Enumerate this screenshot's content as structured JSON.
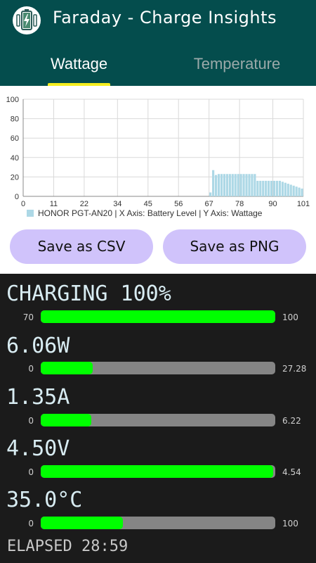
{
  "app": {
    "title": "Faraday - Charge Insights",
    "icon": "battery-charging-icon"
  },
  "tabs": [
    {
      "label": "Wattage",
      "selected": true
    },
    {
      "label": "Temperature",
      "selected": false
    }
  ],
  "colors": {
    "header": "#044d4d",
    "tab_indicator": "#f5ee1f",
    "bar_color": "#add8e6",
    "gauge_fill": "#00ff00",
    "gauge_track": "#858585",
    "button_bg": "#d0c3fb"
  },
  "chart_data": {
    "type": "bar",
    "legend": "HONOR PGT-AN20 | X Axis: Battery Level | Y Axis: Wattage",
    "legend_position": "bottom-left",
    "grid": true,
    "xlim": [
      0,
      101
    ],
    "ylim": [
      0,
      100
    ],
    "x_ticks": [
      "0",
      "11",
      "22",
      "34",
      "45",
      "56",
      "67",
      "78",
      "90",
      "101"
    ],
    "y_ticks": [
      "0",
      "20",
      "40",
      "60",
      "80",
      "100"
    ],
    "x": [
      67,
      68,
      69,
      70,
      71,
      72,
      73,
      74,
      75,
      76,
      77,
      78,
      79,
      80,
      81,
      82,
      83,
      84,
      85,
      86,
      87,
      88,
      89,
      90,
      91,
      92,
      93,
      94,
      95,
      96,
      97,
      98,
      99,
      100
    ],
    "values": [
      4,
      27,
      22,
      23,
      23,
      23,
      23,
      23,
      23,
      23,
      23,
      23,
      23,
      23,
      23,
      23,
      23,
      16,
      16,
      16,
      16,
      16,
      16,
      16,
      16,
      16,
      15,
      14,
      13,
      12,
      11,
      10,
      9,
      8
    ]
  },
  "buttons": {
    "csv": "Save as CSV",
    "png": "Save as PNG"
  },
  "status": {
    "charging": {
      "label": "CHARGING 100%",
      "min": "70",
      "max": "100",
      "fill": 1.0
    },
    "wattage": {
      "label": "6.06W",
      "min": "0",
      "max": "27.28",
      "fill": 0.222
    },
    "current": {
      "label": "1.35A",
      "min": "0",
      "max": "6.22",
      "fill": 0.217
    },
    "voltage": {
      "label": "4.50V",
      "min": "0",
      "max": "4.54",
      "fill": 0.991
    },
    "temperature": {
      "label": "35.0°C",
      "min": "0",
      "max": "100",
      "fill": 0.35
    }
  },
  "elapsed": "ELAPSED 28:59"
}
